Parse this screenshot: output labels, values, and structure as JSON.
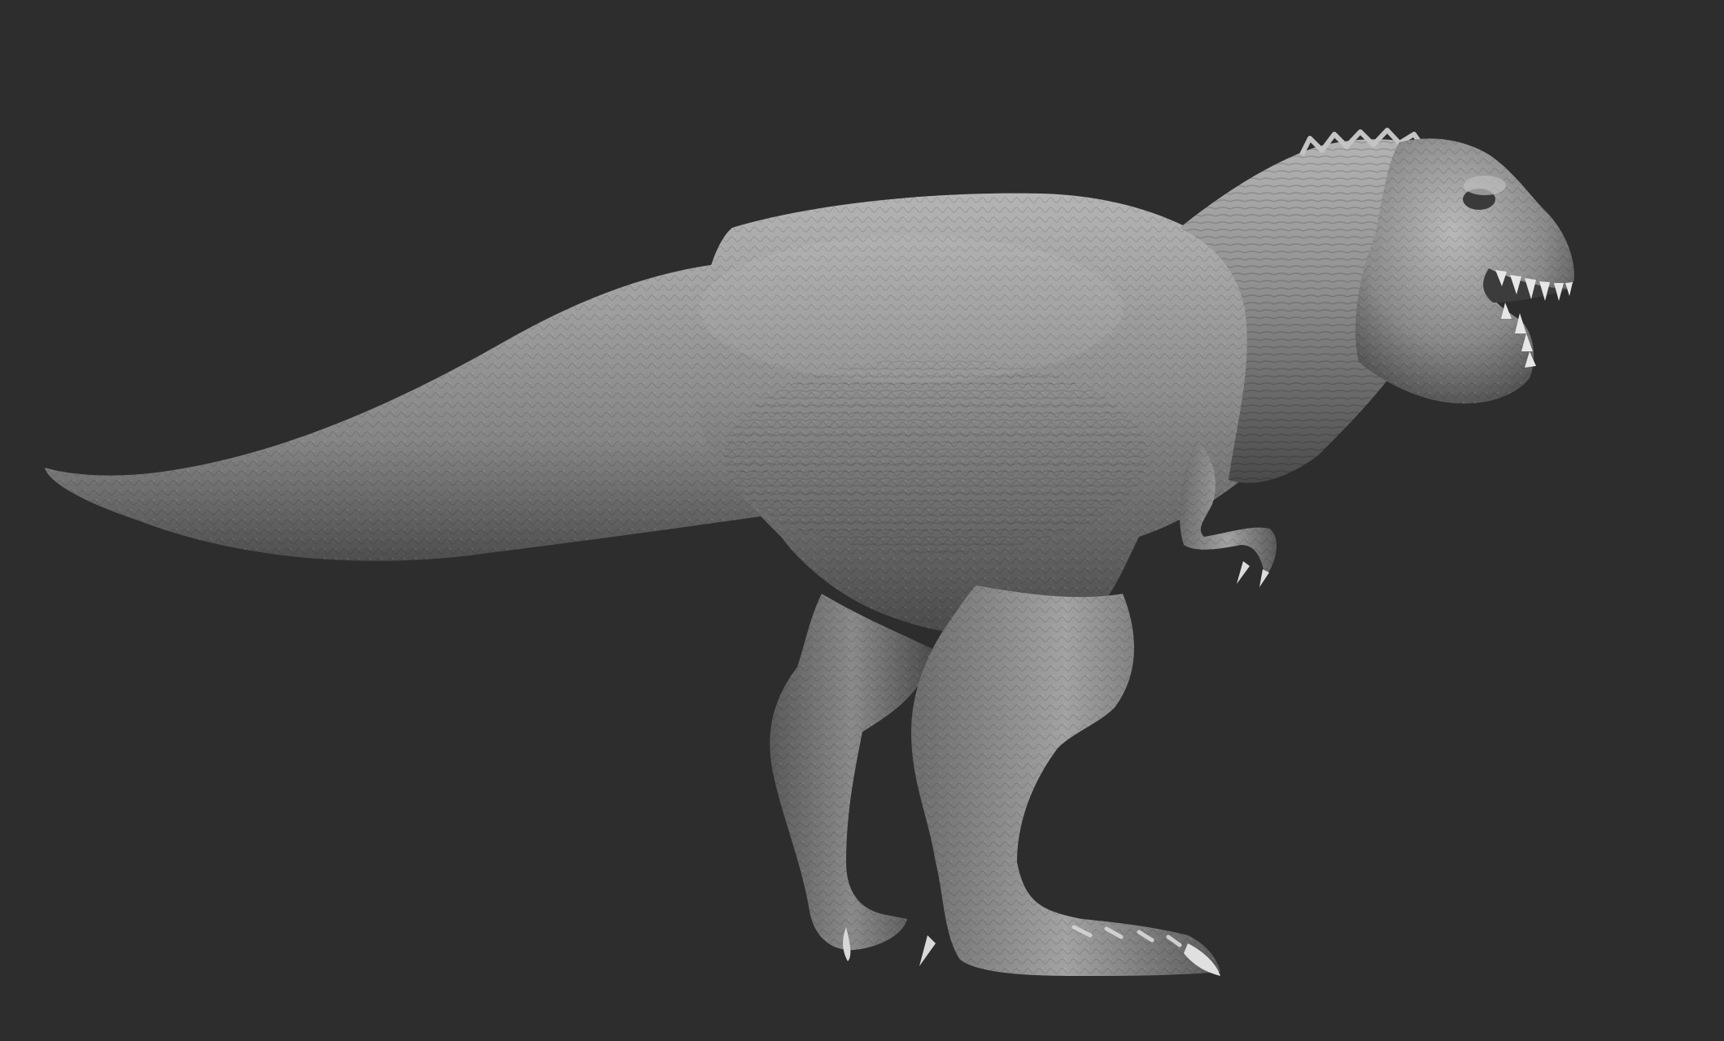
{
  "scene": {
    "background_color": "#2d2d2d",
    "subject": "trex-sculpt",
    "material_base": "#8c8c8c",
    "material_highlight": "#cfcfcf",
    "material_shadow": "#3e3e3e",
    "teeth_color": "#e6e6e6"
  }
}
